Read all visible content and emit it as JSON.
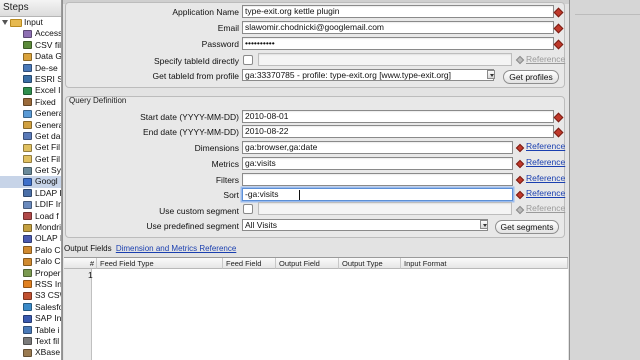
{
  "steps_panel": {
    "title": "Steps",
    "folder": "Input",
    "items": [
      {
        "label": "Access",
        "color": "#8e6fb3"
      },
      {
        "label": "CSV fil",
        "color": "#5b8a3a"
      },
      {
        "label": "Data G",
        "color": "#d9a23b"
      },
      {
        "label": "De-se",
        "color": "#4a79b8"
      },
      {
        "label": "ESRI S",
        "color": "#3a6ea5"
      },
      {
        "label": "Excel I",
        "color": "#2f8f4e"
      },
      {
        "label": "Fixed",
        "color": "#9a6a3a"
      },
      {
        "label": "Genera",
        "color": "#5a9ad6"
      },
      {
        "label": "Genera",
        "color": "#d0a040"
      },
      {
        "label": "Get da",
        "color": "#5a7ab8"
      },
      {
        "label": "Get Fil",
        "color": "#e0c060"
      },
      {
        "label": "Get Fil",
        "color": "#e0c060"
      },
      {
        "label": "Get Sy",
        "color": "#6a8a9a"
      },
      {
        "label": "Googl",
        "color": "#3d6fc9",
        "selected": true
      },
      {
        "label": "LDAP I",
        "color": "#4a6fa8"
      },
      {
        "label": "LDIF In",
        "color": "#6a8abd"
      },
      {
        "label": "Load f",
        "color": "#b04848"
      },
      {
        "label": "Mondri",
        "color": "#c4a040"
      },
      {
        "label": "OLAP I",
        "color": "#4a5ab0"
      },
      {
        "label": "Palo C",
        "color": "#d08a30"
      },
      {
        "label": "Palo C",
        "color": "#d08a30"
      },
      {
        "label": "Proper",
        "color": "#7a9a50"
      },
      {
        "label": "RSS In",
        "color": "#e08020"
      },
      {
        "label": "S3 CS\\",
        "color": "#c05030"
      },
      {
        "label": "Salesfo",
        "color": "#3a8ac8"
      },
      {
        "label": "SAP In",
        "color": "#3a5ab0"
      },
      {
        "label": "Table i",
        "color": "#4a7ab8"
      },
      {
        "label": "Text fil",
        "color": "#7a7a7a"
      },
      {
        "label": "XBase",
        "color": "#9a7a50"
      }
    ]
  },
  "form": {
    "application_name": {
      "label": "Application Name",
      "value": "type-exit.org kettle plugin"
    },
    "email": {
      "label": "Email",
      "value": "slawomir.chodnicki@googlemail.com"
    },
    "password": {
      "label": "Password",
      "value": "••••••••••"
    },
    "specify_tableid": {
      "label": "Specify tableId directly",
      "reference": "Reference"
    },
    "get_tableid": {
      "label": "Get tableId from profile",
      "value": "ga:33370785 - profile: type-exit.org [www.type-exit.org]",
      "button": "Get profiles"
    }
  },
  "query_definition": {
    "title": "Query Definition",
    "start_date": {
      "label": "Start date (YYYY-MM-DD)",
      "value": "2010-08-01"
    },
    "end_date": {
      "label": "End date (YYYY-MM-DD)",
      "value": "2010-08-22"
    },
    "dimensions": {
      "label": "Dimensions",
      "value": "ga:browser,ga:date",
      "reference": "Reference"
    },
    "metrics": {
      "label": "Metrics",
      "value": "ga:visits",
      "reference": "Reference"
    },
    "filters": {
      "label": "Filters",
      "value": "",
      "reference": "Reference"
    },
    "sort": {
      "label": "Sort",
      "value": "-ga:visits",
      "reference": "Reference"
    },
    "custom_segment": {
      "label": "Use custom segment",
      "reference": "Reference"
    },
    "predefined_segment": {
      "label": "Use predefined segment",
      "value": "All Visits",
      "button": "Get segments"
    }
  },
  "output_fields": {
    "label": "Output Fields",
    "link": "Dimension and Metrics Reference",
    "columns": [
      "#",
      "Feed Field Type",
      "Feed Field",
      "Output Field",
      "Output Type",
      "Input Format"
    ],
    "rows": [
      {
        "num": "1"
      }
    ]
  }
}
